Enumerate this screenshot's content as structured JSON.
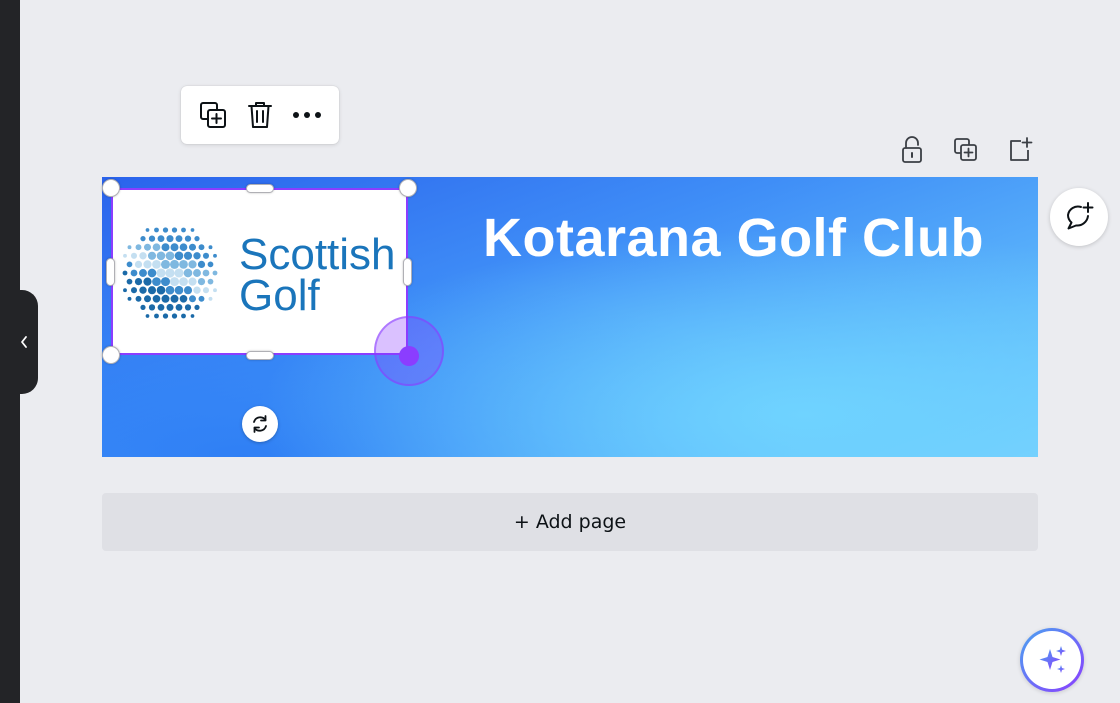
{
  "canvas": {
    "title": "Kotarana Golf Club",
    "logo": {
      "line1": "Scottish",
      "line2": "Golf"
    }
  },
  "element_toolbar": {
    "buttons": [
      {
        "icon": "duplicate-icon"
      },
      {
        "icon": "trash-icon"
      },
      {
        "icon": "more-horizontal-icon"
      }
    ]
  },
  "page_actions": [
    {
      "icon": "unlock-icon"
    },
    {
      "icon": "duplicate-page-icon"
    },
    {
      "icon": "add-page-icon"
    }
  ],
  "add_page": {
    "label": "+ Add page"
  },
  "colors": {
    "selection": "#8b3dff",
    "logo_blue": "#1a75bb",
    "canvas_bg": "#ebecf0",
    "rail": "#232427"
  }
}
